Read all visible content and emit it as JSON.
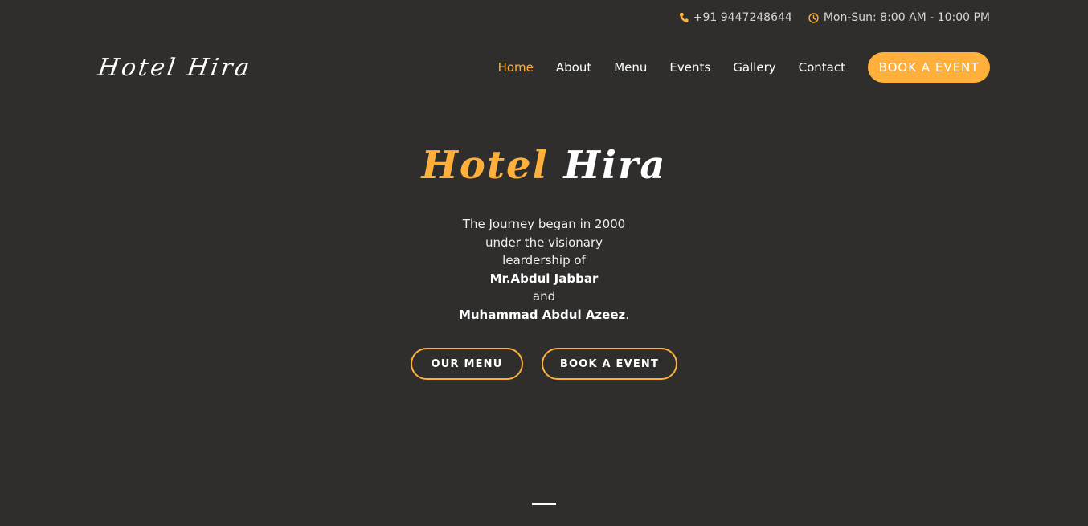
{
  "topbar": {
    "phone": "+91 9447248644",
    "hours": "Mon-Sun: 8:00 AM - 10:00 PM",
    "phone_icon": "phone-icon",
    "clock_icon": "clock-icon"
  },
  "header": {
    "logo": "Hotel Hira",
    "nav": [
      "Home",
      "About",
      "Menu",
      "Events",
      "Gallery",
      "Contact"
    ],
    "active_nav": "Home",
    "book_button": "BOOK A EVENT"
  },
  "hero": {
    "title_first": "Hotel",
    "title_second": "Hira",
    "text_line1": "The Journey began in 2000 under the visionary leardership of",
    "name1": "Mr.Abdul Jabbar",
    "connector": "and",
    "name2": "Muhammad Abdul Azeez",
    "end_punct": ".",
    "menu_button": "OUR MENU",
    "book_button": "BOOK A EVENT"
  },
  "colors": {
    "accent": "#ffb03b",
    "background": "#2f2e2c",
    "text": "#ffffff"
  }
}
